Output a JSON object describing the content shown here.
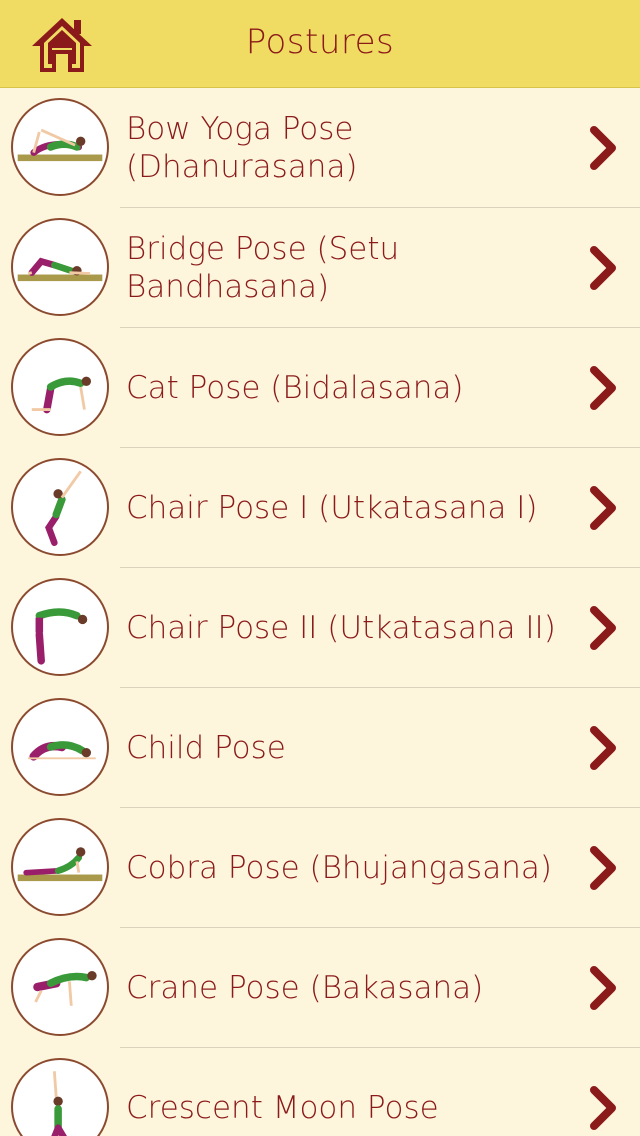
{
  "header": {
    "title": "Postures",
    "home_icon": "home-icon"
  },
  "colors": {
    "header_bg": "#f0dc62",
    "list_bg": "#fdf6dc",
    "accent": "#8b1a1a",
    "pose_top": "#3a9a3a",
    "pose_bottom": "#9a1f6a",
    "mat": "#a89a4a"
  },
  "postures": [
    {
      "label": "Bow Yoga Pose (Dhanurasana)",
      "icon": "bow-pose-thumbnail"
    },
    {
      "label": "Bridge Pose (Setu Bandhasana)",
      "icon": "bridge-pose-thumbnail"
    },
    {
      "label": "Cat Pose (Bidalasana)",
      "icon": "cat-pose-thumbnail"
    },
    {
      "label": "Chair Pose I (Utkatasana I)",
      "icon": "chair-pose-1-thumbnail"
    },
    {
      "label": "Chair Pose II (Utkatasana II)",
      "icon": "chair-pose-2-thumbnail"
    },
    {
      "label": "Child Pose",
      "icon": "child-pose-thumbnail"
    },
    {
      "label": "Cobra Pose (Bhujangasana)",
      "icon": "cobra-pose-thumbnail"
    },
    {
      "label": "Crane Pose (Bakasana)",
      "icon": "crane-pose-thumbnail"
    },
    {
      "label": "Crescent Moon Pose",
      "icon": "crescent-moon-pose-thumbnail"
    }
  ]
}
